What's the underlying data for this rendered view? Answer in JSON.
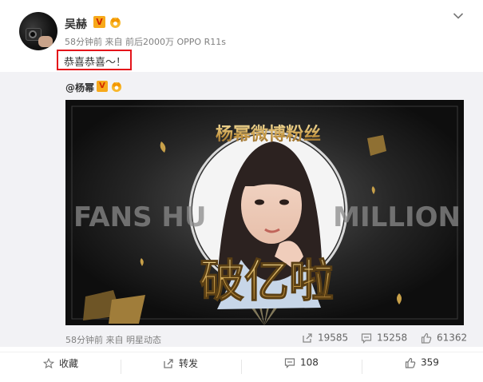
{
  "post": {
    "author": "吴赫",
    "verified_badge": "V",
    "time": "58分钟前",
    "source_prefix": "来自",
    "source": "前后2000万 OPPO R11s",
    "text": "恭喜恭喜～！"
  },
  "repost": {
    "mention": "@杨幂",
    "verified_badge": "V",
    "poster": {
      "headline_cn": "杨幂微博粉丝",
      "headline_en": "FANS HU",
      "headline_en_right": "MILLION",
      "big_text": "破亿啦"
    },
    "time": "58分钟前",
    "source_prefix": "来自",
    "source": "明星动态",
    "stats": {
      "reposts": "19585",
      "comments": "15258",
      "likes": "61362"
    }
  },
  "actions": {
    "favorite": "收藏",
    "repost": "转发",
    "comments": "108",
    "likes": "359"
  },
  "icons": [
    "chevron-down-icon",
    "verified-v-icon",
    "vip-crown-icon",
    "share-icon",
    "comment-icon",
    "thumbs-up-icon",
    "star-icon"
  ],
  "colors": {
    "accent_red": "#e4141a",
    "badge_orange": "#f7a91a",
    "gold": "#c9a85a"
  }
}
